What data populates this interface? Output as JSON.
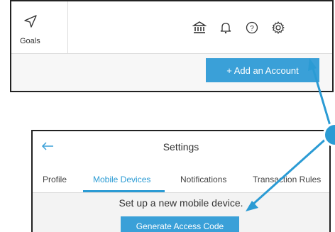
{
  "top_bar": {
    "goals_label": "Goals",
    "icons": [
      "bank-icon",
      "bell-icon",
      "help-icon",
      "gear-icon"
    ]
  },
  "accounts": {
    "add_button_label": "+ Add an Account"
  },
  "settings": {
    "title": "Settings",
    "tabs": [
      {
        "label": "Profile"
      },
      {
        "label": "Mobile Devices",
        "active": true
      },
      {
        "label": "Notifications"
      },
      {
        "label": "Transaction Rules"
      }
    ],
    "mobile": {
      "heading": "Set up a new mobile device.",
      "generate_button_label": "Generate Access Code"
    }
  },
  "colors": {
    "accent": "#3aa0d8",
    "tab_active": "#2b9bd4",
    "border": "#222222"
  }
}
